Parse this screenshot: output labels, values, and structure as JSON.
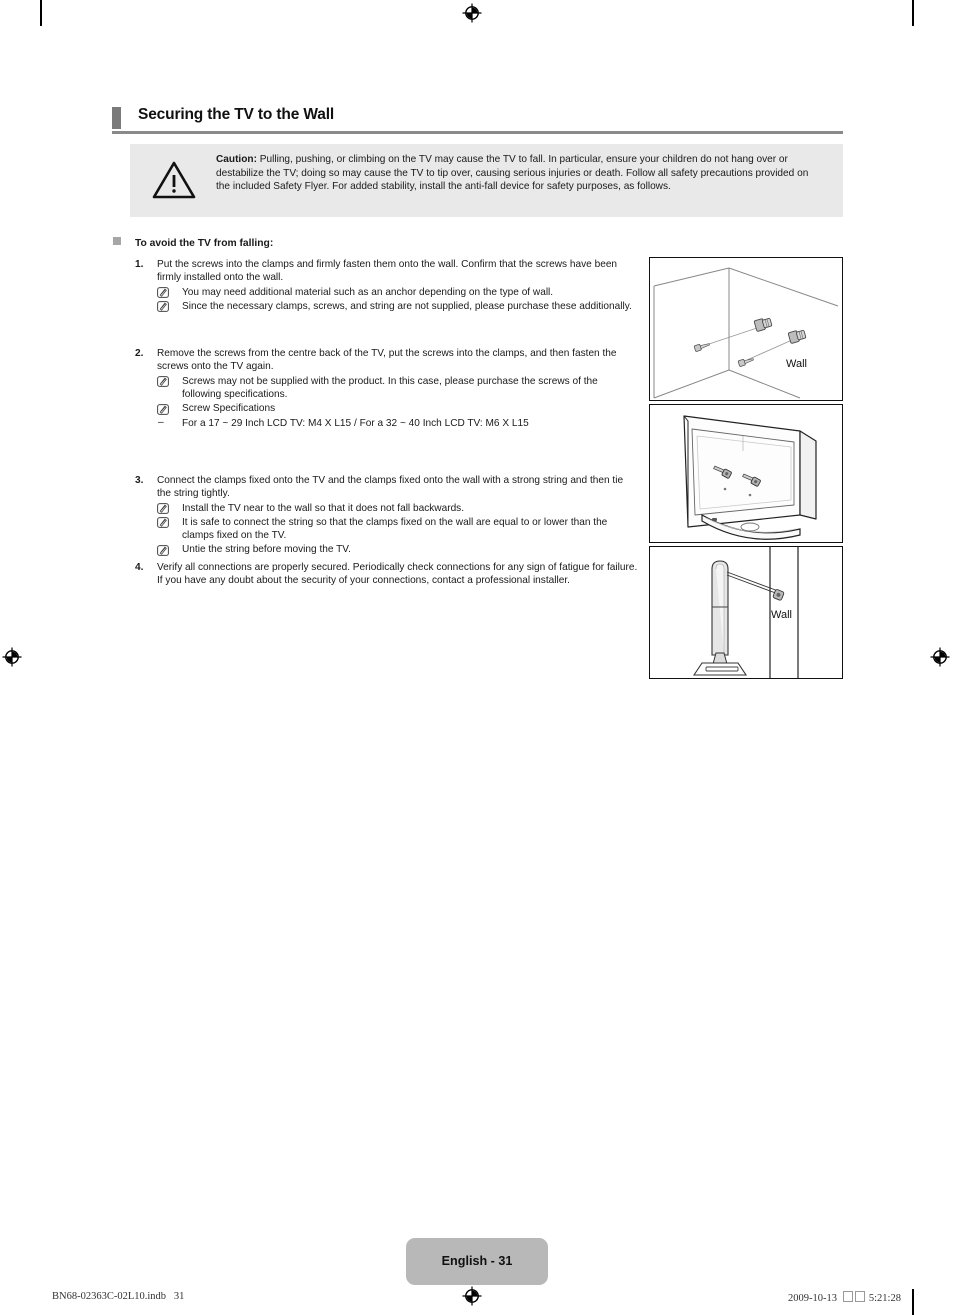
{
  "header": {
    "title": "Securing the TV to the Wall"
  },
  "caution": {
    "label": "Caution:",
    "body": " Pulling, pushing, or climbing on the TV may cause the TV to fall. In particular, ensure your children do not hang over or destabilize the TV; doing so may cause the TV to tip over, causing serious injuries or death. Follow all safety precautions provided on the included Safety Flyer. For added stability, install the anti-fall device for safety purposes, as follows."
  },
  "subhead": "To avoid the TV from falling:",
  "steps": [
    {
      "number": "1.",
      "text": "Put the screws into the clamps and firmly fasten them onto the wall. Confirm that the screws have been firmly installed onto the wall.",
      "notes": [
        {
          "marker": "note",
          "text": "You may need additional material such as an anchor depending on the type of wall."
        },
        {
          "marker": "note",
          "text": "Since the necessary clamps, screws, and string are not supplied, please purchase these additionally."
        }
      ]
    },
    {
      "number": "2.",
      "text": "Remove the screws from the centre back of the TV, put the screws into the clamps, and then fasten the screws onto the TV again.",
      "notes": [
        {
          "marker": "note",
          "text": "Screws may not be supplied with the product. In this case, please purchase the screws of the following specifications."
        },
        {
          "marker": "note",
          "text": "Screw Specifications"
        },
        {
          "marker": "dash",
          "text": "For a 17 ~ 29 Inch LCD TV: M4 X L15 / For a 32 ~ 40 Inch LCD TV: M6 X L15"
        }
      ]
    },
    {
      "number": "3.",
      "text": "Connect the clamps fixed onto the TV and the clamps fixed onto the wall with a strong string and then tie the string tightly.",
      "notes": [
        {
          "marker": "note",
          "text": "Install the TV near to the wall so that it does not fall backwards."
        },
        {
          "marker": "note",
          "text": "It is safe to connect the string so that the clamps fixed on the wall are equal to or lower than the clamps fixed on the TV."
        },
        {
          "marker": "note",
          "text": "Untie the string before moving the TV."
        }
      ]
    },
    {
      "number": "4.",
      "text": "Verify all connections are properly secured. Periodically check connections for any sign of fatigue for failure. If you have any doubt about the security of your connections, contact a professional installer.",
      "notes": []
    }
  ],
  "illustrations": [
    {
      "name": "wall-corner-with-clamps",
      "label": "Wall"
    },
    {
      "name": "tv-rear-with-screws",
      "label": ""
    },
    {
      "name": "tv-side-tethered-to-wall",
      "label": "Wall"
    }
  ],
  "footer": {
    "page_badge": "English - 31",
    "imprint_left": "BN68-02363C-02L10.indb   31",
    "imprint_date": "2009-10-13",
    "imprint_time": "5:21:28"
  },
  "colors": {
    "header_bar": "#7a7a7a",
    "caution_bg": "#e9e9e9",
    "badge_bg": "#b8b8b8",
    "bullet": "#a6a6a6"
  }
}
